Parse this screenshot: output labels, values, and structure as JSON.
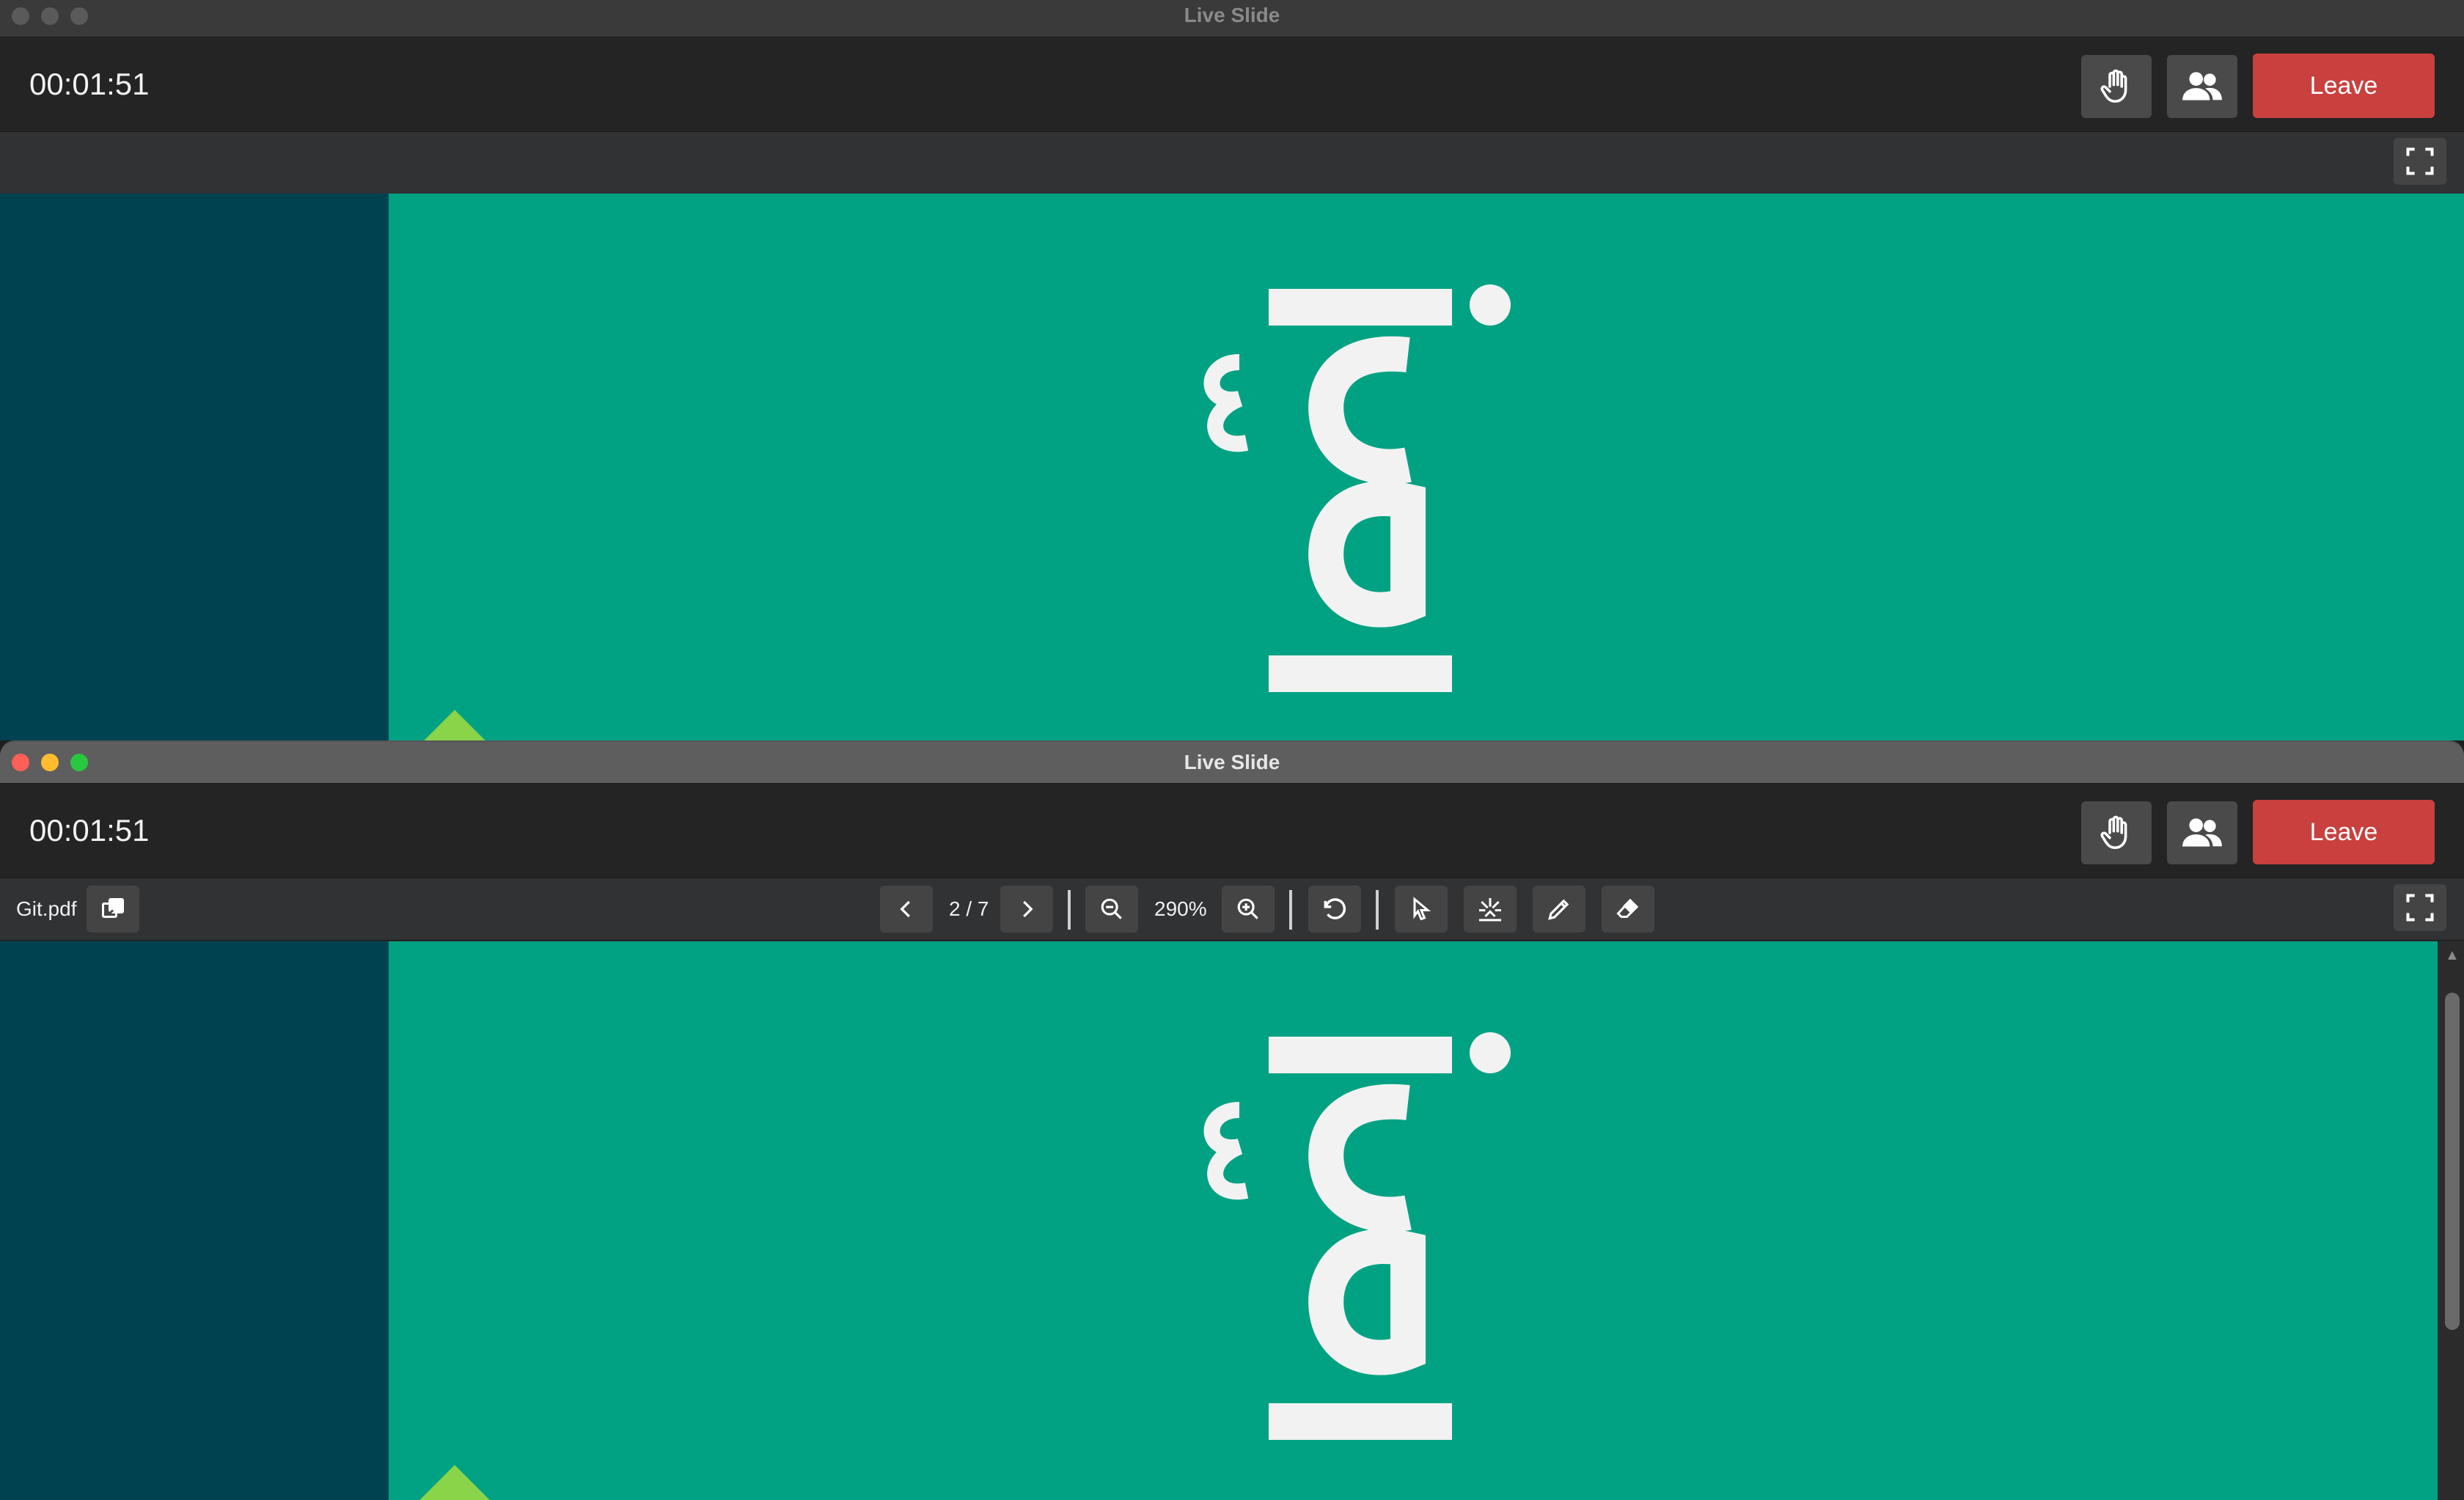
{
  "window_back": {
    "title": "Live Slide",
    "timer": "00:01:51",
    "leave_label": "Leave"
  },
  "window_front": {
    "title": "Live Slide",
    "timer": "00:01:51",
    "leave_label": "Leave",
    "toolbar": {
      "file_name": "Git.pdf",
      "page_indicator": "2 / 7",
      "zoom_level": "290%"
    }
  },
  "icons": [
    "raise-hand-icon",
    "participants-icon",
    "fullscreen-icon",
    "file-switch-icon",
    "prev-page-icon",
    "next-page-icon",
    "zoom-out-icon",
    "zoom-in-icon",
    "rotate-icon",
    "pointer-icon",
    "laser-icon",
    "pen-icon",
    "eraser-icon"
  ],
  "colors": {
    "leave": "#c9403f",
    "slide_teal": "#00a283",
    "slide_dark": "#00424f",
    "accent_green": "#8ad449"
  }
}
